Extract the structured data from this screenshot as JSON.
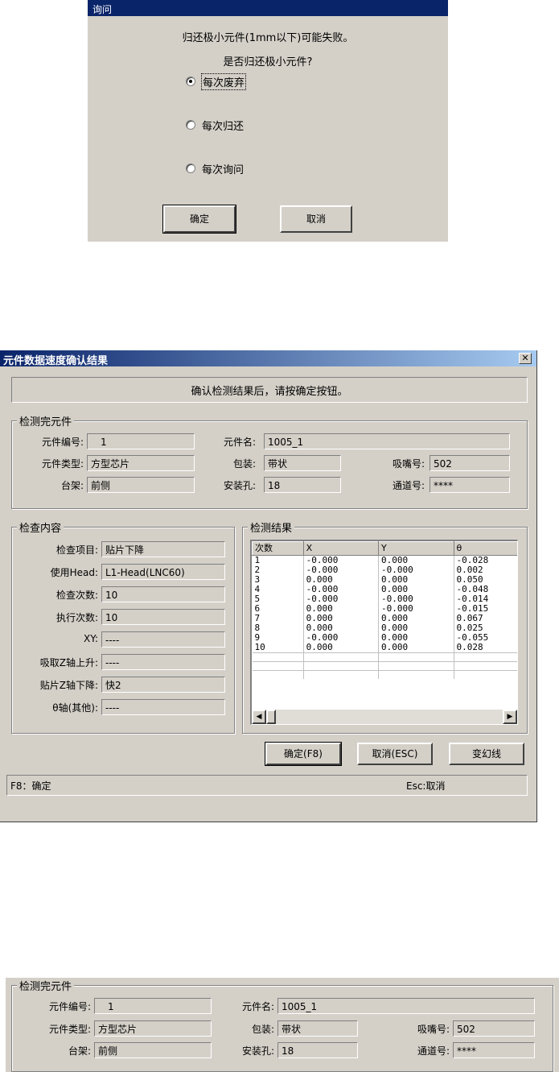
{
  "dialog1": {
    "title": "询问",
    "message1": "归还极小元件(1mm以下)可能失败。",
    "message2": "是否归还极小元件?",
    "options": [
      {
        "label": "每次废弃",
        "checked": true
      },
      {
        "label": "每次归还",
        "checked": false
      },
      {
        "label": "每次询问",
        "checked": false
      }
    ],
    "ok_label": "确定",
    "cancel_label": "取消"
  },
  "dialog2": {
    "title": "元件数据速度确认结果",
    "close_icon": "close-icon",
    "instruction": "确认检测结果后，请按确定按钮。",
    "component_group": {
      "title": "检测完元件",
      "component_no_label": "元件编号:",
      "component_no": "1",
      "component_name_label": "元件名:",
      "component_name": "1005_1",
      "component_type_label": "元件类型:",
      "component_type": "方型芯片",
      "package_label": "包装:",
      "package": "带状",
      "nozzle_label": "吸嘴号:",
      "nozzle": "502",
      "stage_label": "台架:",
      "stage": "前侧",
      "hole_label": "安装孔:",
      "hole": "18",
      "channel_label": "通道号:",
      "channel": "****"
    },
    "check_group": {
      "title": "检查内容",
      "rows": [
        {
          "label": "检查项目:",
          "value": "贴片下降"
        },
        {
          "label": "使用Head:",
          "value": "L1-Head(LNC60)"
        },
        {
          "label": "检查次数:",
          "value": "10"
        },
        {
          "label": "执行次数:",
          "value": "10"
        },
        {
          "label": "XY:",
          "value": "----"
        },
        {
          "label": "吸取Z轴上升:",
          "value": "----"
        },
        {
          "label": "贴片Z轴下降:",
          "value": "快2"
        },
        {
          "label": "θ轴(其他):",
          "value": "----"
        }
      ]
    },
    "result_group": {
      "title": "检测结果",
      "columns": [
        "次数",
        "X",
        "Y",
        "θ"
      ],
      "rows": [
        [
          "1",
          "-0.000",
          "0.000",
          "-0.028"
        ],
        [
          "2",
          "-0.000",
          "-0.000",
          "0.002"
        ],
        [
          "3",
          "0.000",
          "0.000",
          "0.050"
        ],
        [
          "4",
          "-0.000",
          "0.000",
          "-0.048"
        ],
        [
          "5",
          "-0.000",
          "-0.000",
          "-0.014"
        ],
        [
          "6",
          "0.000",
          "-0.000",
          "-0.015"
        ],
        [
          "7",
          "0.000",
          "0.000",
          "0.067"
        ],
        [
          "8",
          "0.000",
          "0.000",
          "0.025"
        ],
        [
          "9",
          "-0.000",
          "0.000",
          "-0.055"
        ],
        [
          "10",
          "0.000",
          "0.000",
          "0.028"
        ]
      ]
    },
    "ok_label": "确定(F8)",
    "cancel_label": "取消(ESC)",
    "phantom_label": "变幻线",
    "status_left": "F8：确定",
    "status_right": "Esc:取消"
  },
  "crop": {
    "title": "检测完元件",
    "component_no_label": "元件编号:",
    "component_no": "1",
    "component_name_label": "元件名:",
    "component_name": "1005_1",
    "component_type_label": "元件类型:",
    "component_type": "方型芯片",
    "package_label": "包装:",
    "package": "带状",
    "nozzle_label": "吸嘴号:",
    "nozzle": "502",
    "stage_label": "台架:",
    "stage": "前侧",
    "hole_label": "安装孔:",
    "hole": "18",
    "channel_label": "通道号:",
    "channel": "****"
  }
}
